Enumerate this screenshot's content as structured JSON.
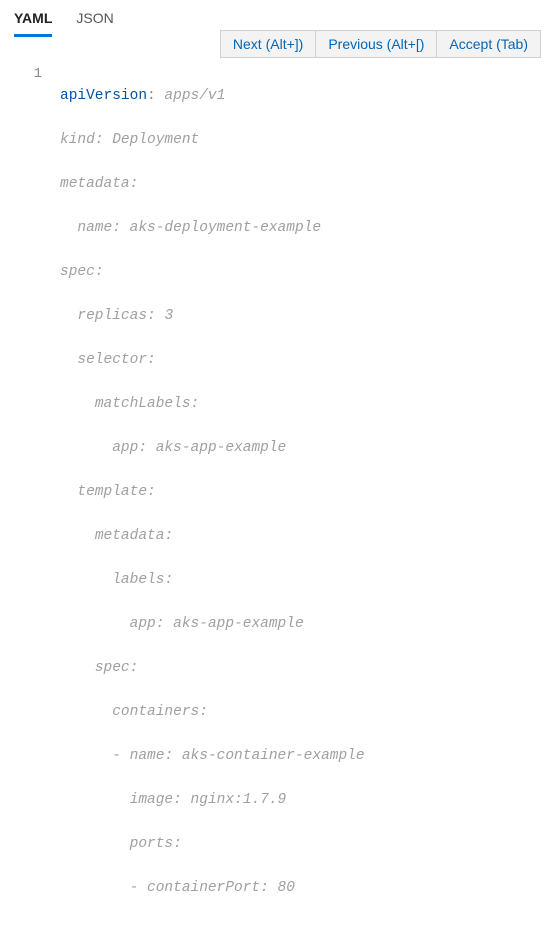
{
  "tabs": {
    "yaml": "YAML",
    "json": "JSON"
  },
  "suggestBar": {
    "next": "Next (Alt+])",
    "prev": "Previous (Alt+[)",
    "accept": "Accept (Tab)"
  },
  "lineNumber": "1",
  "code": {
    "l1_key": "apiVersion",
    "l1_val": "apps/v1",
    "l2_key": "kind",
    "l2_val": "Deployment",
    "l3_key": "metadata",
    "l4_key": "name",
    "l4_val": "aks-deployment-example",
    "l5_key": "spec",
    "l6_key": "replicas",
    "l6_val": "3",
    "l7_key": "selector",
    "l8_key": "matchLabels",
    "l9_key": "app",
    "l9_val": "aks-app-example",
    "l10_key": "template",
    "l11_key": "metadata",
    "l12_key": "labels",
    "l13_key": "app",
    "l13_val": "aks-app-example",
    "l14_key": "spec",
    "l15_key": "containers",
    "l16_key": "name",
    "l16_val": "aks-container-example",
    "l17_key": "image",
    "l17_val": "nginx:1.7.9",
    "l18_key": "ports",
    "l19_key": "containerPort",
    "l19_val": "80"
  }
}
